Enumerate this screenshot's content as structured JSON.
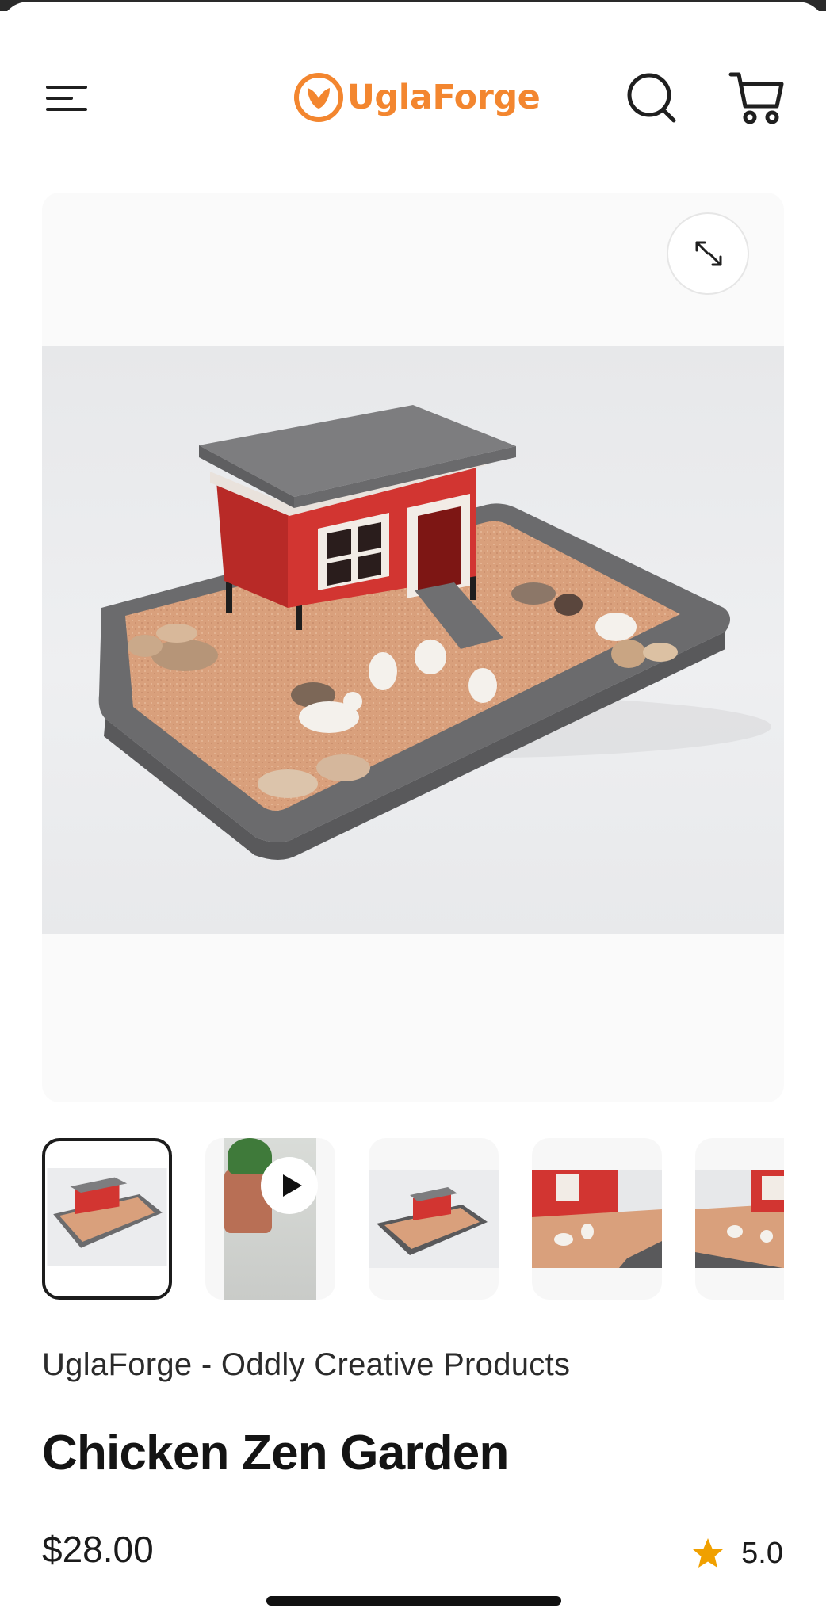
{
  "header": {
    "logo_text": "UglaForge",
    "brand_color": "#f3862f",
    "icons": {
      "menu": "menu-icon",
      "search": "search-icon",
      "cart": "cart-icon"
    }
  },
  "gallery": {
    "expand_icon": "expand-icon",
    "thumbnails": [
      {
        "kind": "image",
        "active": true
      },
      {
        "kind": "video",
        "icon": "play-icon"
      },
      {
        "kind": "image"
      },
      {
        "kind": "image"
      },
      {
        "kind": "image"
      }
    ]
  },
  "product": {
    "vendor": "UglaForge - Oddly Creative Products",
    "title": "Chicken Zen Garden",
    "price": "$28.00",
    "rating": "5.0",
    "star_color": "#f0a000"
  }
}
